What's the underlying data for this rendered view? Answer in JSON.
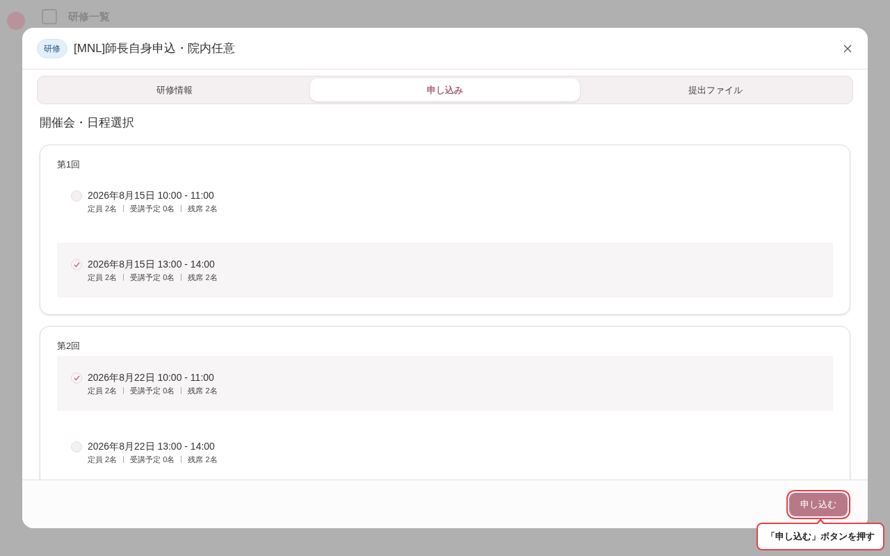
{
  "app_header": {
    "title": "研修一覧"
  },
  "dialog": {
    "tag": "研修",
    "title": "[MNL]師長自身申込・院内任意"
  },
  "tabs": [
    {
      "label": "研修情報",
      "selected": false
    },
    {
      "label": "申し込み",
      "selected": true
    },
    {
      "label": "提出ファイル",
      "selected": false
    }
  ],
  "section_title": "開催会・日程選択",
  "sessions": [
    {
      "label": "第1回",
      "slots": [
        {
          "datetime": "2026年8月15日 10:00 - 11:00",
          "capacity": "定員 2名",
          "planned": "受講予定 0名",
          "remaining": "残席 2名",
          "checked": false
        },
        {
          "datetime": "2026年8月15日 13:00 - 14:00",
          "capacity": "定員 2名",
          "planned": "受講予定 0名",
          "remaining": "残席 2名",
          "checked": true
        }
      ]
    },
    {
      "label": "第2回",
      "slots": [
        {
          "datetime": "2026年8月22日 10:00 - 11:00",
          "capacity": "定員 2名",
          "planned": "受講予定 0名",
          "remaining": "残席 2名",
          "checked": true
        },
        {
          "datetime": "2026年8月22日 13:00 - 14:00",
          "capacity": "定員 2名",
          "planned": "受講予定 0名",
          "remaining": "残席 2名",
          "checked": false
        }
      ]
    }
  ],
  "submit_button": "申し込む",
  "callout": "「申し込む」ボタンを押す"
}
